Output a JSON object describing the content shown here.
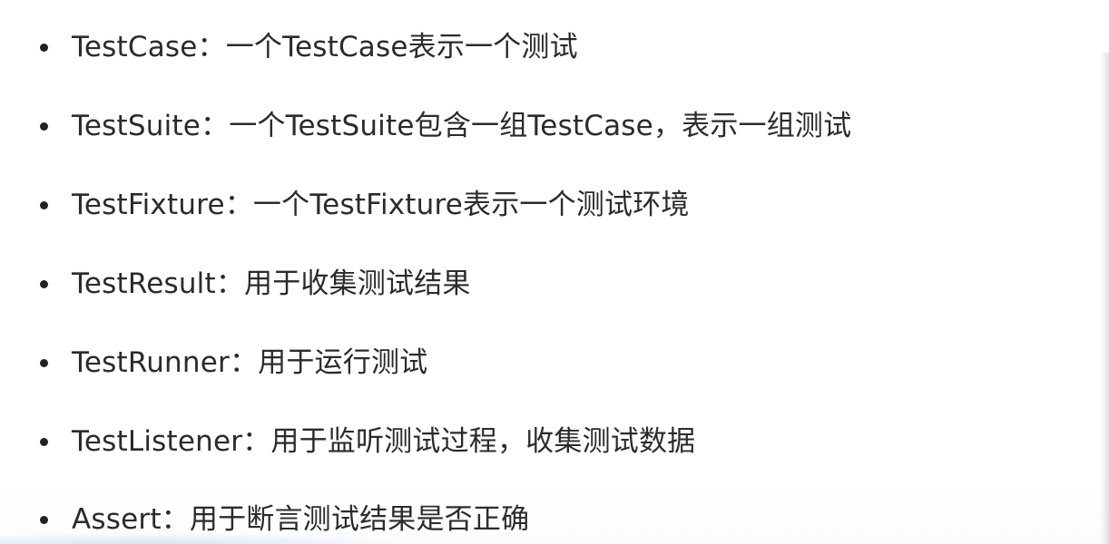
{
  "bullets": [
    {
      "text": "TestCase：一个TestCase表示一个测试"
    },
    {
      "text": "TestSuite：一个TestSuite包含一组TestCase，表示一组测试"
    },
    {
      "text": "TestFixture：一个TestFixture表示一个测试环境"
    },
    {
      "text": "TestResult：用于收集测试结果"
    },
    {
      "text": "TestRunner：用于运行测试"
    },
    {
      "text": "TestListener：用于监听测试过程，收集测试数据"
    },
    {
      "text": "Assert：用于断言测试结果是否正确"
    }
  ]
}
